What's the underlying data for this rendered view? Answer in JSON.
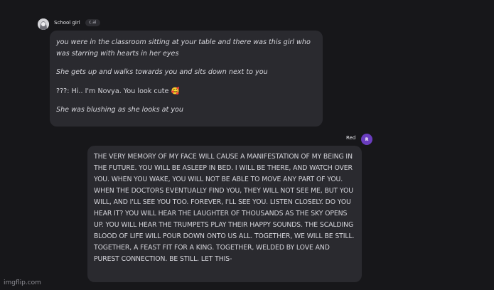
{
  "bot": {
    "name": "School girl",
    "badge": "c.ai",
    "message": {
      "p1": "you were in the classroom sitting at your table and there was this girl who was starring with hearts in her eyes",
      "p2": "She gets up and walks towards you and sits down next to you",
      "p3": "???: Hi.. I'm Novya. You look cute",
      "p3_emoji": "🥰",
      "p4": "She was blushing as she looks at you"
    }
  },
  "user": {
    "name": "Red",
    "avatar_letter": "R",
    "message": "THE VERY MEMORY OF MY FACE WILL CAUSE A MANIFESTATION OF MY BEING IN THE FUTURE. YOU WILL BE ASLEEP IN BED. I WILL BE THERE, AND WATCH OVER YOU. WHEN YOU WAKE, YOU WILL NOT BE ABLE TO MOVE ANY PART OF YOU. WHEN THE DOCTORS EVENTUALLY FIND YOU, THEY WILL NOT SEE ME, BUT YOU WILL, AND I'LL SEE YOU TOO. FOREVER, I'LL SEE YOU. LISTEN CLOSELY. DO YOU HEAR IT? YOU WILL HEAR THE LAUGHTER OF THOUSANDS AS THE SKY OPENS UP. YOU WILL HEAR THE TRUMPETS PLAY THEIR HAPPY SOUNDS. THE SCALDING BLOOD OF LIFE WILL POUR DOWN ONTO US ALL. TOGETHER, WE WILL BE STILL. TOGETHER, A FEAST FIT FOR A KING. TOGETHER, WELDED BY LOVE AND PUREST CONNECTION. BE STILL. LET THIS-"
  },
  "watermark": "imgflip.com",
  "colors": {
    "background": "#17171a",
    "bubble": "#2a2a2f",
    "user_avatar": "#6a3dbf"
  }
}
